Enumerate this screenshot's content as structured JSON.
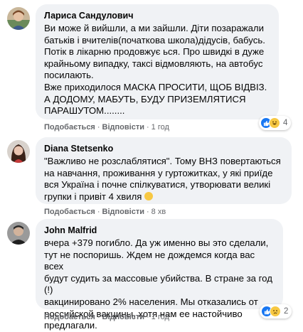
{
  "comments": [
    {
      "author": "Лариса Сандулович",
      "text": "Ви може й вийшли, а ми зайшли. Діти позаражали\nбатьків і вчителів(початкова школа)дідусів, бабусь.\nПотік в лікарню продовжує ься. Про швидкі в дуже\nкрайньому випадку, таксі відмовляють, на автобус\nпосилають.\nВже приходилося МАСКА ПРОСИТИ, ЩОБ ВІДВІЗ.\nА ДОДОМУ, МАБУТЬ, БУДУ ПРИЗЕМЛЯТИСЯ\nПАРАШУТОМ........",
      "like_label": "Подобається",
      "reply_label": "Відповісти",
      "time": "1 год",
      "reaction_count": "4",
      "reaction_icons": [
        "like-icon",
        "haha-icon"
      ]
    },
    {
      "author": "Diana Stetsenko",
      "text": "\"Важливо не розслаблятися\". Тому ВНЗ повертаються\nна навчання, проживання у гуртожитках, у які приїде\nвся Україна і почне спілкуватися, утворювати великі\nгрупки і привіт 4 хвиля",
      "like_label": "Подобається",
      "reply_label": "Відповісти",
      "time": "8 хв",
      "reaction_count": "",
      "reaction_icons": []
    },
    {
      "author": "John Malfrid",
      "text": "вчера +379 погибло. Да уж именно вы это сделали,\nтут не поспоришь. Ждем не дождемся когда вас всех\nбудут судить за массовые убийства. В стране за год (!)\nвакцинировано 2% населения. Мы отказались от\nроссийской вакцины, хотя нам ее настойчиво\nпредлагали.",
      "like_label": "Подобається",
      "reply_label": "Відповісти",
      "time": "1 год",
      "reaction_count": "2",
      "reaction_icons": [
        "like-icon",
        "sad-icon"
      ]
    }
  ],
  "colors": {
    "bubble": "#f0f2f5",
    "like": "#1877f2",
    "emoji": "#f7c843",
    "meta": "#65676b"
  }
}
